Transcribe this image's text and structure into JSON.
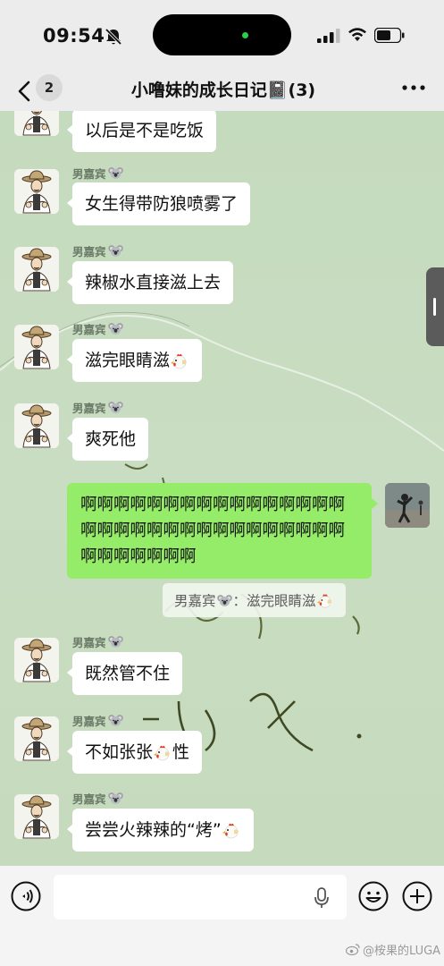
{
  "status_bar": {
    "time": "09:54"
  },
  "header": {
    "unread_count": "2",
    "title": "小噜妹的成长日记📓(3)"
  },
  "messages": [
    {
      "sender": "",
      "text": "以后是不是吃饭"
    },
    {
      "sender": "男嘉宾",
      "text": "女生得带防狼喷雾了"
    },
    {
      "sender": "男嘉宾",
      "text": "辣椒水直接滋上去"
    },
    {
      "sender": "男嘉宾",
      "text": "滋完眼睛滋"
    },
    {
      "sender": "男嘉宾",
      "text": "爽死他"
    },
    {
      "sender": "",
      "text": "啊啊啊啊啊啊啊啊啊啊啊啊啊啊啊啊啊啊啊啊啊啊啊啊啊啊啊啊啊啊啊啊啊啊啊啊啊啊啊"
    },
    {
      "sender": "男嘉宾",
      "text": "既然管不住"
    },
    {
      "sender": "男嘉宾",
      "text_before": "不如张张",
      "text_after": "性"
    },
    {
      "sender": "男嘉宾",
      "text": "尝尝火辣辣的“烤”"
    }
  ],
  "quote": {
    "sender": "男嘉宾",
    "separator": "：",
    "text": "滋完眼睛滋"
  },
  "input": {
    "placeholder": ""
  },
  "watermark": "@桉果的LUGA",
  "colors": {
    "my_bubble": "#95ec69",
    "their_bubble": "#ffffff",
    "chat_bg": "#c8dcc0"
  }
}
